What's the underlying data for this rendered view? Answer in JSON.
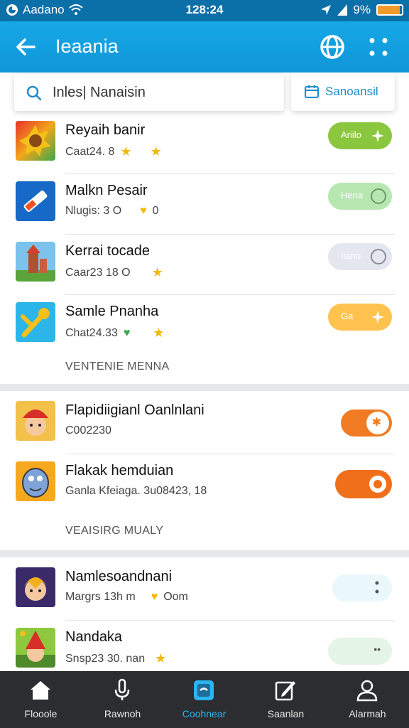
{
  "status_bar": {
    "carrier": "Aadano",
    "time": "128:24",
    "battery": "9%",
    "battery_level": 0.9
  },
  "app_bar": {
    "title": "Ieaania",
    "back_icon": "arrow-left-icon",
    "globe_icon": "globe-icon",
    "more_icon": "more-icon"
  },
  "search": {
    "value": "Inles| Nanaisin",
    "side_label": "Sanoansil"
  },
  "list_items": [
    {
      "name": "Reyaih banir",
      "meta": "Caat24. 8",
      "toggle_label": "Ariilo",
      "toggle_color": "#8bc63f"
    },
    {
      "name": "Malkn Pesair",
      "meta": "Nlugis: 3  O",
      "meta2": "0",
      "toggle_label": "Hena",
      "toggle_color": "#b6e7b0"
    },
    {
      "name": "Kerrai tocade",
      "meta": "Caar23 18 O",
      "toggle_label": "Iiano",
      "toggle_color": "#e4e6f0"
    },
    {
      "name": "Samle Pnanha",
      "meta": "Chat24.33",
      "toggle_label": "Ga",
      "toggle_color": "#ffc24e"
    }
  ],
  "section_1": {
    "label": "VENTENIE MENNA"
  },
  "list_items_2": [
    {
      "name": "Flapidiigianl Oanlnlani",
      "meta": "C002230"
    },
    {
      "name": "Flakak hemduian",
      "meta": "Ganla Kfeiaga. 3u08423, 18"
    }
  ],
  "section_2": {
    "label": "VEAISIRG MUALY"
  },
  "list_items_3": [
    {
      "name": "Namlesoandnani",
      "meta": "Margrs 13h m",
      "meta2": "Oom"
    },
    {
      "name": "Nandaka",
      "meta": "Snsp23 30. nan"
    }
  ],
  "bottom_nav": [
    {
      "label": "Flooole",
      "icon": "home-icon"
    },
    {
      "label": "Rawnoh",
      "icon": "microphone-icon"
    },
    {
      "label": "Coohnear",
      "icon": "tablet-icon",
      "active": true
    },
    {
      "label": "Saanlan",
      "icon": "edit-icon"
    },
    {
      "label": "Alarmah",
      "icon": "user-icon"
    }
  ],
  "colors": {
    "accent": "#16a8e6",
    "orange": "#f06f1a",
    "nav_bg": "#2b2d30"
  }
}
